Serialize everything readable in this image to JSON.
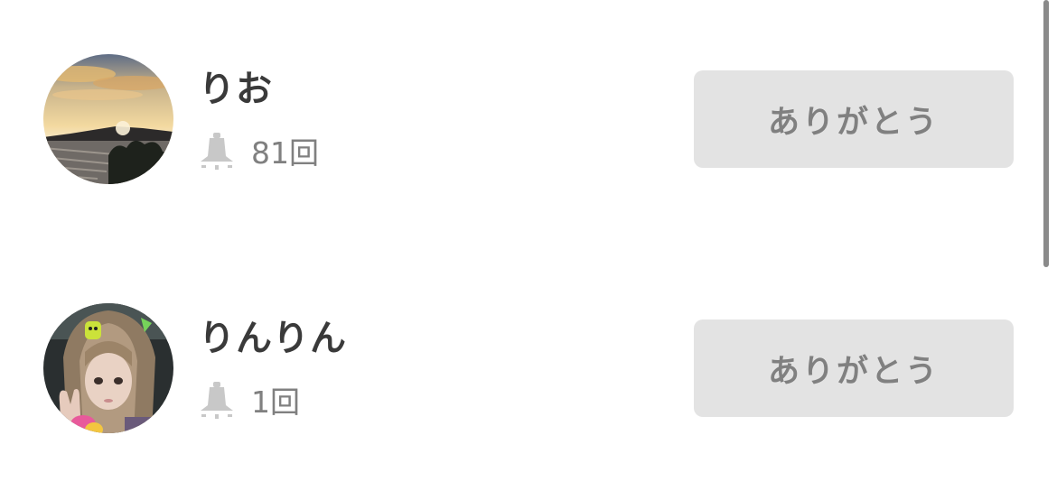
{
  "supporters": [
    {
      "name": "りお",
      "count": "81回",
      "button_label": "ありがとう",
      "avatar_icon": "sunset-landscape-photo",
      "bell_icon": "bell-icon"
    },
    {
      "name": "りんりん",
      "count": "1回",
      "button_label": "ありがとう",
      "avatar_icon": "girl-portrait-photo",
      "bell_icon": "bell-icon"
    }
  ],
  "colors": {
    "name_text": "#3a3a3a",
    "count_text": "#808080",
    "button_bg": "#e3e3e3",
    "button_text": "#808080",
    "bell": "#c8c8c8",
    "scrollbar": "#8a8a8a"
  }
}
